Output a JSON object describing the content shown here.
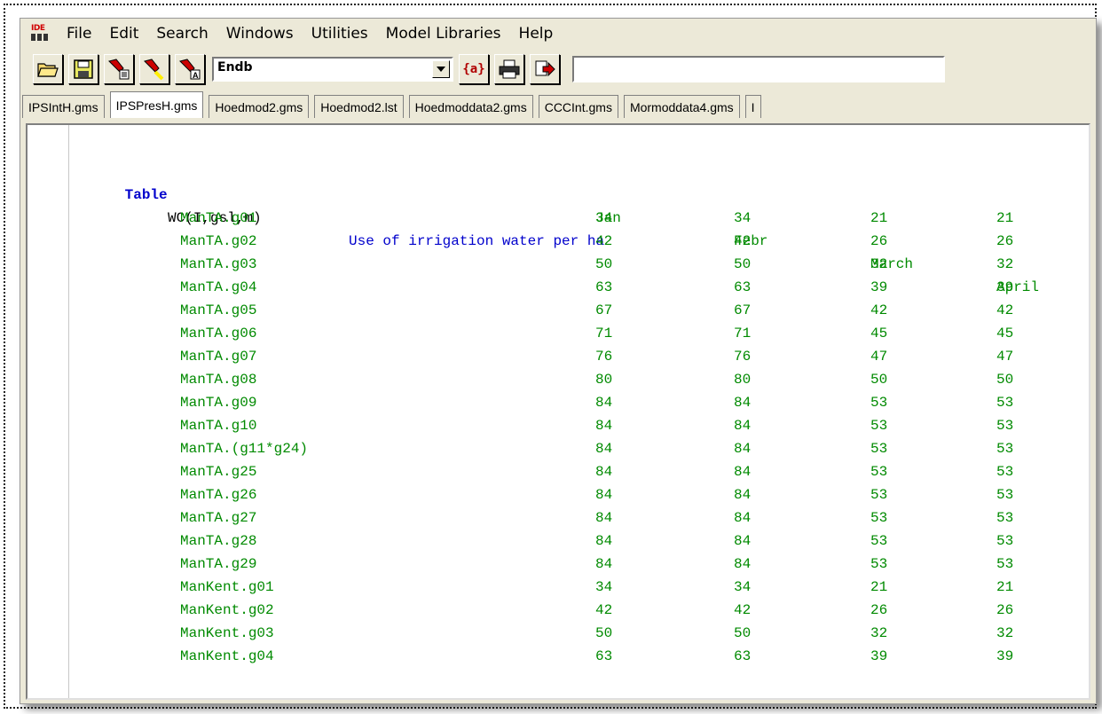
{
  "menu": {
    "items": [
      "File",
      "Edit",
      "Search",
      "Windows",
      "Utilities",
      "Model Libraries",
      "Help"
    ]
  },
  "toolbar": {
    "combo_value": "Endb",
    "brace_label": "{a}",
    "buttons": [
      "open-icon",
      "save-icon",
      "run-icon",
      "run-compile-icon",
      "run-a-icon",
      "print-icon",
      "export-icon"
    ]
  },
  "tabs": [
    "IPSIntH.gms",
    "IPSPresH.gms",
    "Hoedmod2.gms",
    "Hoedmod2.lst",
    "Hoedmoddata2.gms",
    "CCCInt.gms",
    "Mormoddata4.gms",
    "I"
  ],
  "active_tab": 1,
  "code": {
    "keyword": "Table",
    "table_name": "WC(I,gsl,m)",
    "description": "Use of irrigation water per ha",
    "columns": [
      "Jan",
      "Febr",
      "March",
      "April"
    ],
    "rows": [
      {
        "label": "ManTA.g01",
        "values": [
          "34",
          "34",
          "21",
          "21"
        ]
      },
      {
        "label": "ManTA.g02",
        "values": [
          "42",
          "42",
          "26",
          "26"
        ]
      },
      {
        "label": "ManTA.g03",
        "values": [
          "50",
          "50",
          "32",
          "32"
        ]
      },
      {
        "label": "ManTA.g04",
        "values": [
          "63",
          "63",
          "39",
          "39"
        ]
      },
      {
        "label": "ManTA.g05",
        "values": [
          "67",
          "67",
          "42",
          "42"
        ]
      },
      {
        "label": "ManTA.g06",
        "values": [
          "71",
          "71",
          "45",
          "45"
        ]
      },
      {
        "label": "ManTA.g07",
        "values": [
          "76",
          "76",
          "47",
          "47"
        ]
      },
      {
        "label": "ManTA.g08",
        "values": [
          "80",
          "80",
          "50",
          "50"
        ]
      },
      {
        "label": "ManTA.g09",
        "values": [
          "84",
          "84",
          "53",
          "53"
        ]
      },
      {
        "label": "ManTA.g10",
        "values": [
          "84",
          "84",
          "53",
          "53"
        ]
      },
      {
        "label": "ManTA.(g11*g24)",
        "values": [
          "84",
          "84",
          "53",
          "53"
        ]
      },
      {
        "label": "ManTA.g25",
        "values": [
          "84",
          "84",
          "53",
          "53"
        ]
      },
      {
        "label": "ManTA.g26",
        "values": [
          "84",
          "84",
          "53",
          "53"
        ]
      },
      {
        "label": "ManTA.g27",
        "values": [
          "84",
          "84",
          "53",
          "53"
        ]
      },
      {
        "label": "ManTA.g28",
        "values": [
          "84",
          "84",
          "53",
          "53"
        ]
      },
      {
        "label": "ManTA.g29",
        "values": [
          "84",
          "84",
          "53",
          "53"
        ]
      },
      {
        "label": "ManKent.g01",
        "values": [
          "34",
          "34",
          "21",
          "21"
        ]
      },
      {
        "label": "ManKent.g02",
        "values": [
          "42",
          "42",
          "26",
          "26"
        ]
      },
      {
        "label": "ManKent.g03",
        "values": [
          "50",
          "50",
          "32",
          "32"
        ]
      },
      {
        "label": "ManKent.g04",
        "values": [
          "63",
          "63",
          "39",
          "39"
        ]
      }
    ]
  }
}
